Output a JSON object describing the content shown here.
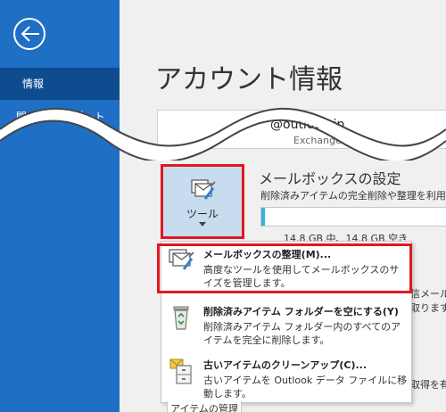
{
  "sidebar": {
    "items": [
      {
        "label": "情報"
      },
      {
        "label": "開く/エクスポート"
      }
    ]
  },
  "page_title": "アカウント情報",
  "account": {
    "email": "@outlook.jp",
    "type": "Exchange"
  },
  "tools_button": {
    "label": "ツール"
  },
  "mailbox": {
    "title": "メールボックスの設定",
    "desc": "削除済みアイテムの完全削除や整理を利用",
    "size_text": "14.8 GB 中、14.8 GB 空き",
    "progress_fraction": 0.02
  },
  "side_texts": [
    "信メール",
    "取ります",
    "取得を有"
  ],
  "menu": {
    "items": [
      {
        "title": "メールボックスの整理(M)...",
        "desc": "高度なツールを使用してメールボックスのサイズを管理します。"
      },
      {
        "title": "削除済みアイテム フォルダーを空にする(Y)",
        "desc": "削除済みアイテム フォルダー内のすべてのアイテムを完全に削除します。"
      },
      {
        "title": "古いアイテムのクリーンアップ(C)...",
        "desc": "古いアイテムを Outlook データ ファイルに移動します。"
      }
    ],
    "under_label": "アイテムの管理"
  }
}
